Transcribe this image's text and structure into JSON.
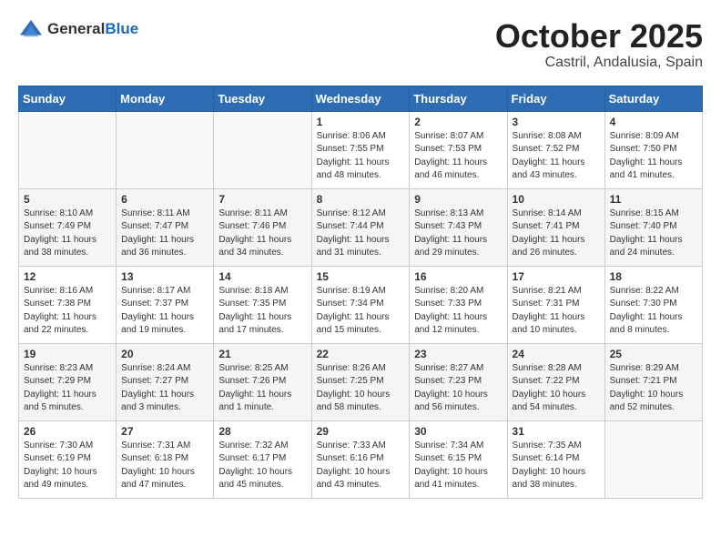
{
  "logo": {
    "general": "General",
    "blue": "Blue"
  },
  "header": {
    "month": "October 2025",
    "location": "Castril, Andalusia, Spain"
  },
  "weekdays": [
    "Sunday",
    "Monday",
    "Tuesday",
    "Wednesday",
    "Thursday",
    "Friday",
    "Saturday"
  ],
  "weeks": [
    [
      {
        "day": "",
        "sunrise": "",
        "sunset": "",
        "daylight": ""
      },
      {
        "day": "",
        "sunrise": "",
        "sunset": "",
        "daylight": ""
      },
      {
        "day": "",
        "sunrise": "",
        "sunset": "",
        "daylight": ""
      },
      {
        "day": "1",
        "sunrise": "Sunrise: 8:06 AM",
        "sunset": "Sunset: 7:55 PM",
        "daylight": "Daylight: 11 hours and 48 minutes."
      },
      {
        "day": "2",
        "sunrise": "Sunrise: 8:07 AM",
        "sunset": "Sunset: 7:53 PM",
        "daylight": "Daylight: 11 hours and 46 minutes."
      },
      {
        "day": "3",
        "sunrise": "Sunrise: 8:08 AM",
        "sunset": "Sunset: 7:52 PM",
        "daylight": "Daylight: 11 hours and 43 minutes."
      },
      {
        "day": "4",
        "sunrise": "Sunrise: 8:09 AM",
        "sunset": "Sunset: 7:50 PM",
        "daylight": "Daylight: 11 hours and 41 minutes."
      }
    ],
    [
      {
        "day": "5",
        "sunrise": "Sunrise: 8:10 AM",
        "sunset": "Sunset: 7:49 PM",
        "daylight": "Daylight: 11 hours and 38 minutes."
      },
      {
        "day": "6",
        "sunrise": "Sunrise: 8:11 AM",
        "sunset": "Sunset: 7:47 PM",
        "daylight": "Daylight: 11 hours and 36 minutes."
      },
      {
        "day": "7",
        "sunrise": "Sunrise: 8:11 AM",
        "sunset": "Sunset: 7:46 PM",
        "daylight": "Daylight: 11 hours and 34 minutes."
      },
      {
        "day": "8",
        "sunrise": "Sunrise: 8:12 AM",
        "sunset": "Sunset: 7:44 PM",
        "daylight": "Daylight: 11 hours and 31 minutes."
      },
      {
        "day": "9",
        "sunrise": "Sunrise: 8:13 AM",
        "sunset": "Sunset: 7:43 PM",
        "daylight": "Daylight: 11 hours and 29 minutes."
      },
      {
        "day": "10",
        "sunrise": "Sunrise: 8:14 AM",
        "sunset": "Sunset: 7:41 PM",
        "daylight": "Daylight: 11 hours and 26 minutes."
      },
      {
        "day": "11",
        "sunrise": "Sunrise: 8:15 AM",
        "sunset": "Sunset: 7:40 PM",
        "daylight": "Daylight: 11 hours and 24 minutes."
      }
    ],
    [
      {
        "day": "12",
        "sunrise": "Sunrise: 8:16 AM",
        "sunset": "Sunset: 7:38 PM",
        "daylight": "Daylight: 11 hours and 22 minutes."
      },
      {
        "day": "13",
        "sunrise": "Sunrise: 8:17 AM",
        "sunset": "Sunset: 7:37 PM",
        "daylight": "Daylight: 11 hours and 19 minutes."
      },
      {
        "day": "14",
        "sunrise": "Sunrise: 8:18 AM",
        "sunset": "Sunset: 7:35 PM",
        "daylight": "Daylight: 11 hours and 17 minutes."
      },
      {
        "day": "15",
        "sunrise": "Sunrise: 8:19 AM",
        "sunset": "Sunset: 7:34 PM",
        "daylight": "Daylight: 11 hours and 15 minutes."
      },
      {
        "day": "16",
        "sunrise": "Sunrise: 8:20 AM",
        "sunset": "Sunset: 7:33 PM",
        "daylight": "Daylight: 11 hours and 12 minutes."
      },
      {
        "day": "17",
        "sunrise": "Sunrise: 8:21 AM",
        "sunset": "Sunset: 7:31 PM",
        "daylight": "Daylight: 11 hours and 10 minutes."
      },
      {
        "day": "18",
        "sunrise": "Sunrise: 8:22 AM",
        "sunset": "Sunset: 7:30 PM",
        "daylight": "Daylight: 11 hours and 8 minutes."
      }
    ],
    [
      {
        "day": "19",
        "sunrise": "Sunrise: 8:23 AM",
        "sunset": "Sunset: 7:29 PM",
        "daylight": "Daylight: 11 hours and 5 minutes."
      },
      {
        "day": "20",
        "sunrise": "Sunrise: 8:24 AM",
        "sunset": "Sunset: 7:27 PM",
        "daylight": "Daylight: 11 hours and 3 minutes."
      },
      {
        "day": "21",
        "sunrise": "Sunrise: 8:25 AM",
        "sunset": "Sunset: 7:26 PM",
        "daylight": "Daylight: 11 hours and 1 minute."
      },
      {
        "day": "22",
        "sunrise": "Sunrise: 8:26 AM",
        "sunset": "Sunset: 7:25 PM",
        "daylight": "Daylight: 10 hours and 58 minutes."
      },
      {
        "day": "23",
        "sunrise": "Sunrise: 8:27 AM",
        "sunset": "Sunset: 7:23 PM",
        "daylight": "Daylight: 10 hours and 56 minutes."
      },
      {
        "day": "24",
        "sunrise": "Sunrise: 8:28 AM",
        "sunset": "Sunset: 7:22 PM",
        "daylight": "Daylight: 10 hours and 54 minutes."
      },
      {
        "day": "25",
        "sunrise": "Sunrise: 8:29 AM",
        "sunset": "Sunset: 7:21 PM",
        "daylight": "Daylight: 10 hours and 52 minutes."
      }
    ],
    [
      {
        "day": "26",
        "sunrise": "Sunrise: 7:30 AM",
        "sunset": "Sunset: 6:19 PM",
        "daylight": "Daylight: 10 hours and 49 minutes."
      },
      {
        "day": "27",
        "sunrise": "Sunrise: 7:31 AM",
        "sunset": "Sunset: 6:18 PM",
        "daylight": "Daylight: 10 hours and 47 minutes."
      },
      {
        "day": "28",
        "sunrise": "Sunrise: 7:32 AM",
        "sunset": "Sunset: 6:17 PM",
        "daylight": "Daylight: 10 hours and 45 minutes."
      },
      {
        "day": "29",
        "sunrise": "Sunrise: 7:33 AM",
        "sunset": "Sunset: 6:16 PM",
        "daylight": "Daylight: 10 hours and 43 minutes."
      },
      {
        "day": "30",
        "sunrise": "Sunrise: 7:34 AM",
        "sunset": "Sunset: 6:15 PM",
        "daylight": "Daylight: 10 hours and 41 minutes."
      },
      {
        "day": "31",
        "sunrise": "Sunrise: 7:35 AM",
        "sunset": "Sunset: 6:14 PM",
        "daylight": "Daylight: 10 hours and 38 minutes."
      },
      {
        "day": "",
        "sunrise": "",
        "sunset": "",
        "daylight": ""
      }
    ]
  ]
}
